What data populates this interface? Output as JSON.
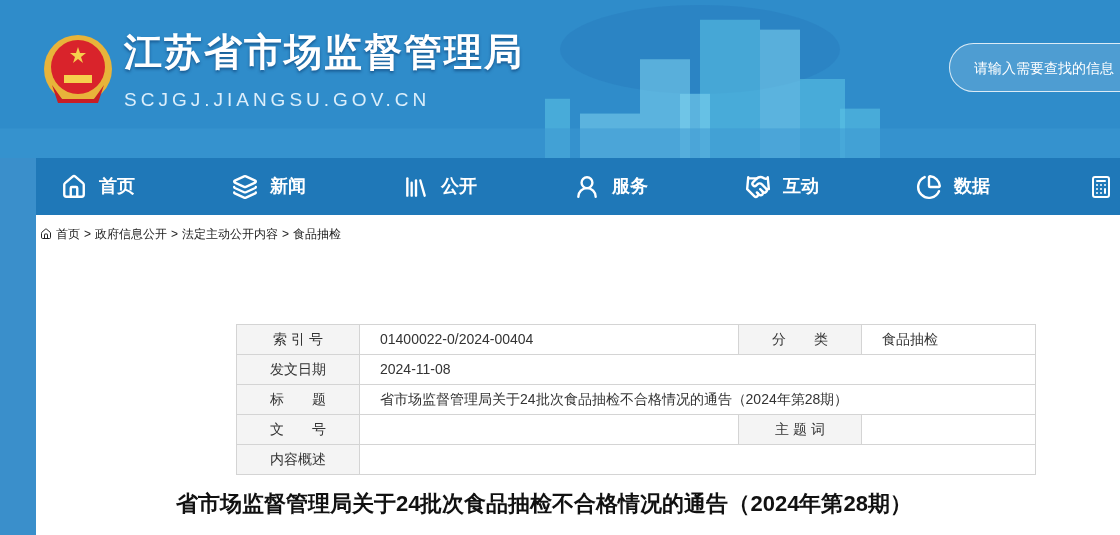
{
  "site": {
    "title": "江苏省市场监督管理局",
    "url": "SCJGJ.JIANGSU.GOV.CN"
  },
  "search": {
    "placeholder": "请输入需要查找的信息"
  },
  "nav": [
    {
      "label": "首页"
    },
    {
      "label": "新闻"
    },
    {
      "label": "公开"
    },
    {
      "label": "服务"
    },
    {
      "label": "互动"
    },
    {
      "label": "数据"
    }
  ],
  "breadcrumb": {
    "separator": ">",
    "items": [
      "首页",
      "政府信息公开",
      "法定主动公开内容",
      "食品抽检"
    ]
  },
  "info_table": [
    {
      "label": "索 引 号",
      "value": "01400022-0/2024-00404",
      "label2": "分　　类",
      "value2": "食品抽检"
    },
    {
      "label": "发文日期",
      "value": "2024-11-08"
    },
    {
      "label": "标　　题",
      "value": "省市场监督管理局关于24批次食品抽检不合格情况的通告（2024年第28期）"
    },
    {
      "label": "文　　号",
      "label2": "主 题 词"
    },
    {
      "label": "内容概述"
    }
  ],
  "article": {
    "title": "省市场监督管理局关于24批次食品抽检不合格情况的通告（2024年第28期）"
  }
}
